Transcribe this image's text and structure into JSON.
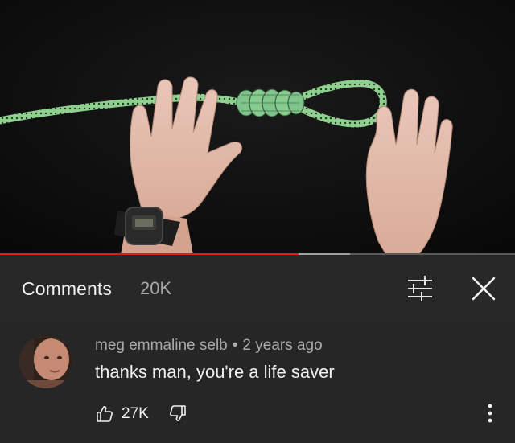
{
  "video": {
    "progress_played_pct": 58,
    "progress_buffered_pct": 68
  },
  "comments_panel": {
    "title": "Comments",
    "count": "20K",
    "filter_icon": "sliders-icon",
    "close_icon": "close-icon"
  },
  "comment": {
    "author": "meg emmaline selb",
    "separator": "•",
    "time": "2 years ago",
    "text": "thanks man, you're a life saver",
    "like_count": "27K",
    "like_icon": "thumbs-up-icon",
    "dislike_icon": "thumbs-down-icon",
    "more_icon": "more-vert-icon"
  },
  "colors": {
    "panel_bg": "#282828",
    "progress_red": "#e01e1e",
    "secondary_text": "#aaaaaa"
  }
}
